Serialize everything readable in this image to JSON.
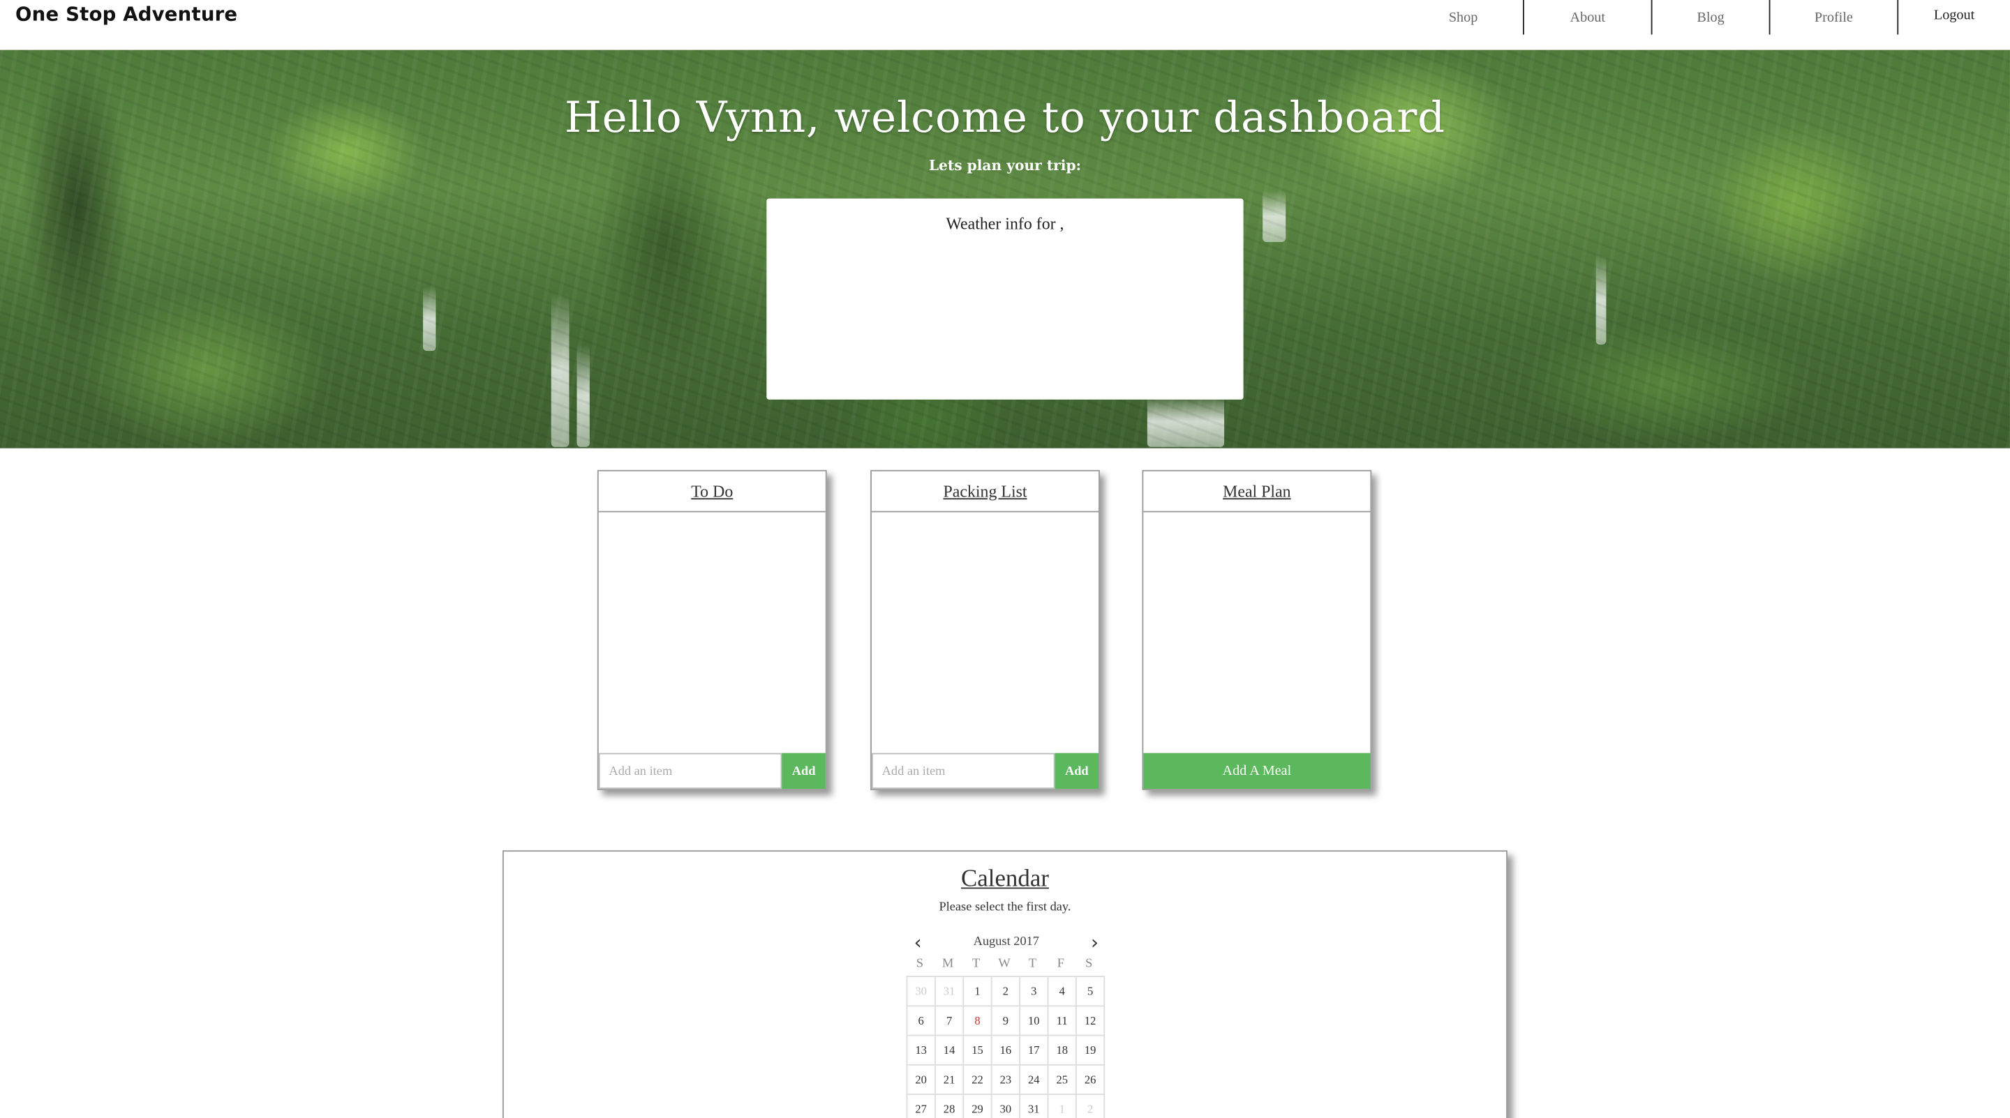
{
  "brand": "One Stop Adventure",
  "nav": {
    "shop": "Shop",
    "about": "About",
    "blog": "Blog",
    "profile": "Profile",
    "logout": "Logout"
  },
  "hero": {
    "title": "Hello Vynn, welcome to your dashboard",
    "subtitle": "Lets plan your trip:",
    "weather_title": "Weather info for ,"
  },
  "cards": {
    "todo": {
      "title": "To Do",
      "placeholder": "Add an item",
      "button": "Add"
    },
    "packing": {
      "title": "Packing List",
      "placeholder": "Add an item",
      "button": "Add"
    },
    "meal": {
      "title": "Meal Plan",
      "button": "Add A Meal"
    }
  },
  "calendar": {
    "title": "Calendar",
    "subtitle": "Please select the first day.",
    "month_label": "August 2017",
    "weekdays": [
      "S",
      "M",
      "T",
      "W",
      "T",
      "F",
      "S"
    ],
    "days": [
      {
        "d": "30",
        "other": true
      },
      {
        "d": "31",
        "other": true
      },
      {
        "d": "1"
      },
      {
        "d": "2"
      },
      {
        "d": "3"
      },
      {
        "d": "4"
      },
      {
        "d": "5"
      },
      {
        "d": "6"
      },
      {
        "d": "7"
      },
      {
        "d": "8",
        "today": true
      },
      {
        "d": "9"
      },
      {
        "d": "10"
      },
      {
        "d": "11"
      },
      {
        "d": "12"
      },
      {
        "d": "13"
      },
      {
        "d": "14"
      },
      {
        "d": "15"
      },
      {
        "d": "16"
      },
      {
        "d": "17"
      },
      {
        "d": "18"
      },
      {
        "d": "19"
      },
      {
        "d": "20"
      },
      {
        "d": "21"
      },
      {
        "d": "22"
      },
      {
        "d": "23"
      },
      {
        "d": "24"
      },
      {
        "d": "25"
      },
      {
        "d": "26"
      },
      {
        "d": "27"
      },
      {
        "d": "28"
      },
      {
        "d": "29"
      },
      {
        "d": "30"
      },
      {
        "d": "31"
      },
      {
        "d": "1",
        "other": true
      },
      {
        "d": "2",
        "other": true
      }
    ]
  },
  "colors": {
    "accent_green": "#5cb85c",
    "today_red": "#c0392b"
  }
}
